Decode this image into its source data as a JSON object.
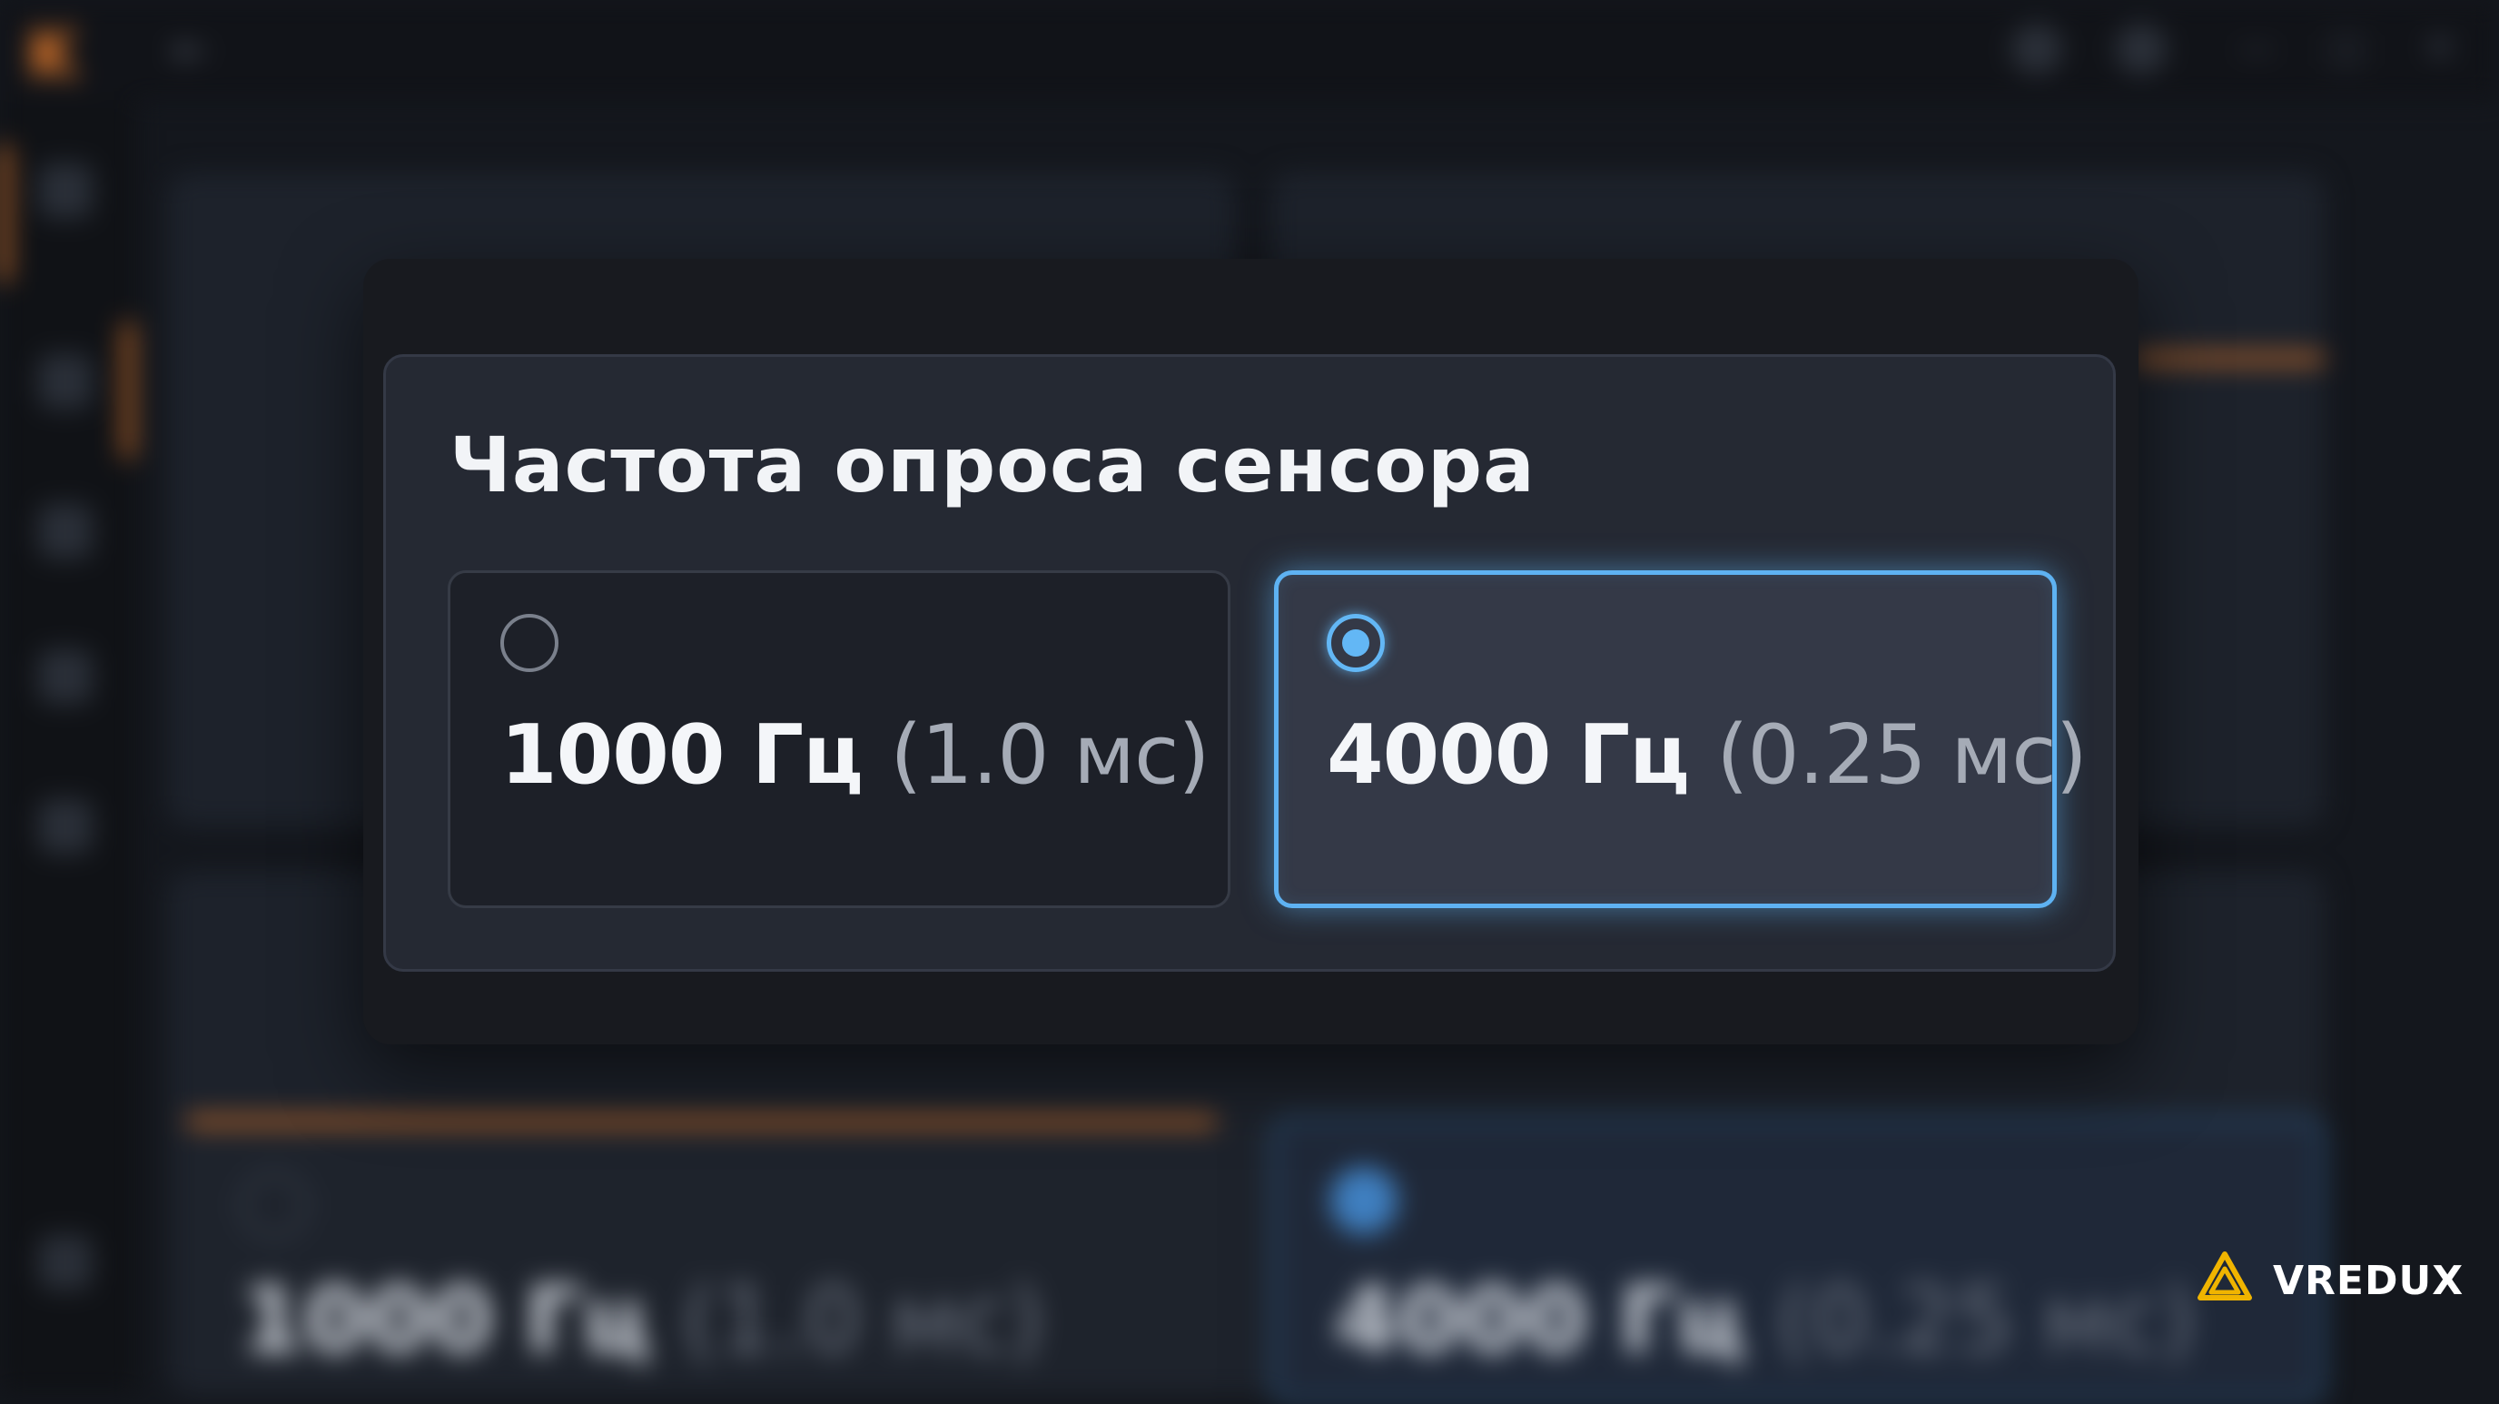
{
  "modal": {
    "title": "Частота опроса сенсора",
    "options": [
      {
        "value": "1000 Гц",
        "detail": "(1.0 мс)",
        "selected": false
      },
      {
        "value": "4000 Гц",
        "detail": "(0.25 мс)",
        "selected": true
      }
    ]
  },
  "colors": {
    "accent": "#e2792b",
    "selection": "#5eb2f2",
    "background": "#14171d"
  },
  "watermark": {
    "text": "VREDUX"
  }
}
